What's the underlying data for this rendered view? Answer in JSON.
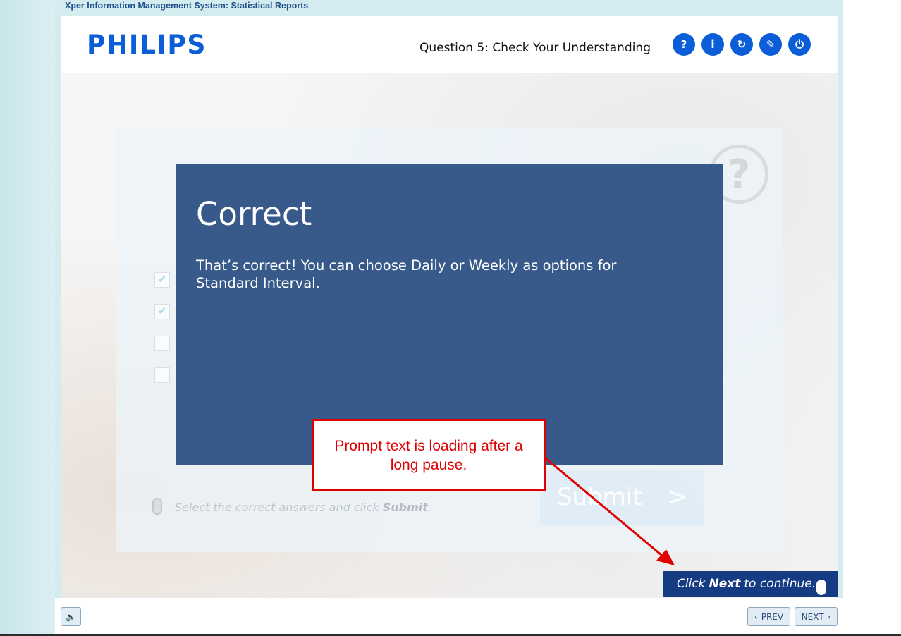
{
  "app": {
    "title": "Xper Information Management System: Statistical Reports",
    "logo_text": "PHILIPS"
  },
  "header": {
    "question_title": "Question 5: Check Your Understanding",
    "icons": [
      {
        "name": "help-icon",
        "glyph": "?"
      },
      {
        "name": "info-icon",
        "glyph": "i"
      },
      {
        "name": "replay-icon",
        "glyph": "↻"
      },
      {
        "name": "resources-icon",
        "glyph": "✎"
      },
      {
        "name": "exit-icon",
        "glyph": "⏻"
      }
    ]
  },
  "quiz": {
    "options_checked": [
      true,
      true,
      false,
      false
    ],
    "instruction_prefix": "Select the correct answers and click ",
    "instruction_bold": "Submit",
    "instruction_suffix": ".",
    "submit_label": "Submit",
    "submit_arrow": ">"
  },
  "feedback": {
    "title": "Correct",
    "body": "That’s correct!  You can choose Daily or Weekly as options for Standard Interval."
  },
  "annotation": {
    "callout_text": "Prompt text is loading after a long pause."
  },
  "continue_prompt": {
    "prefix": "Click",
    "bold": "Next",
    "suffix": "to continue."
  },
  "footer": {
    "audio_icon": "🔈",
    "prev_label": "PREV",
    "next_label": "NEXT"
  },
  "colors": {
    "brand_blue": "#0b5ed7",
    "feedback_bg": "#375a8a",
    "callout_red": "#e00000",
    "prompt_bg": "#153c82"
  }
}
